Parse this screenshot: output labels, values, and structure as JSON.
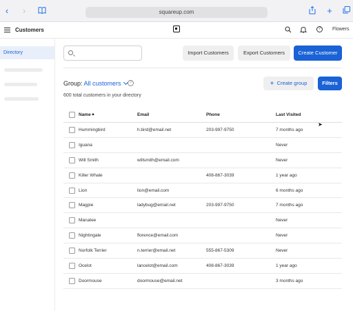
{
  "browser": {
    "url": "squareup.com",
    "back_icon": "chevron-left-icon",
    "forward_icon": "chevron-right-icon",
    "bookmarks_icon": "book-icon",
    "share_icon": "share-icon",
    "new_tab_icon": "plus-icon",
    "tabs_icon": "tabs-icon"
  },
  "header": {
    "title": "Customers",
    "account": "Flowers"
  },
  "sidebar": {
    "active_item": "Directory"
  },
  "toolbar": {
    "search_placeholder": "",
    "import_label": "Import Customers",
    "export_label": "Export Customers",
    "create_label": "Create Customer"
  },
  "group": {
    "prefix": "Group:",
    "value": "All customers",
    "total": "600 total customers in your directory",
    "create_group_label": "Create group",
    "filters_label": "Filters"
  },
  "table": {
    "columns": [
      "Name",
      "Email",
      "Phone",
      "Last Visited"
    ],
    "rows": [
      {
        "name": "Hummingbird",
        "email": "h.bird@email.net",
        "phone": "203-997-9750",
        "visited": "7 months ago"
      },
      {
        "name": "Iguana",
        "email": "",
        "phone": "",
        "visited": "Never"
      },
      {
        "name": "Will Smith",
        "email": "willsmith@email.com",
        "phone": "",
        "visited": "Never"
      },
      {
        "name": "Killer Whale",
        "email": "",
        "phone": "408-867-3039",
        "visited": "1 year ago"
      },
      {
        "name": "Lion",
        "email": "lion@email.com",
        "phone": "",
        "visited": "6 months ago"
      },
      {
        "name": "Magpie",
        "email": "ladybug@email.net",
        "phone": "203-997-9750",
        "visited": "7 months ago"
      },
      {
        "name": "Manatee",
        "email": "",
        "phone": "",
        "visited": "Never"
      },
      {
        "name": "Nightingale",
        "email": "florence@email.com",
        "phone": "",
        "visited": "Never"
      },
      {
        "name": "Norfolk Terrier",
        "email": "n.terrier@email.net",
        "phone": "555-867-5309",
        "visited": "Never"
      },
      {
        "name": "Ocelot",
        "email": "lancelot@email.com",
        "phone": "408-867-3039",
        "visited": "1 year ago"
      },
      {
        "name": "Doormouse",
        "email": "doormouse@email.net",
        "phone": "",
        "visited": "3 months ago"
      }
    ]
  },
  "colors": {
    "accent": "#1a62d6",
    "active_bg": "#e8effa"
  }
}
